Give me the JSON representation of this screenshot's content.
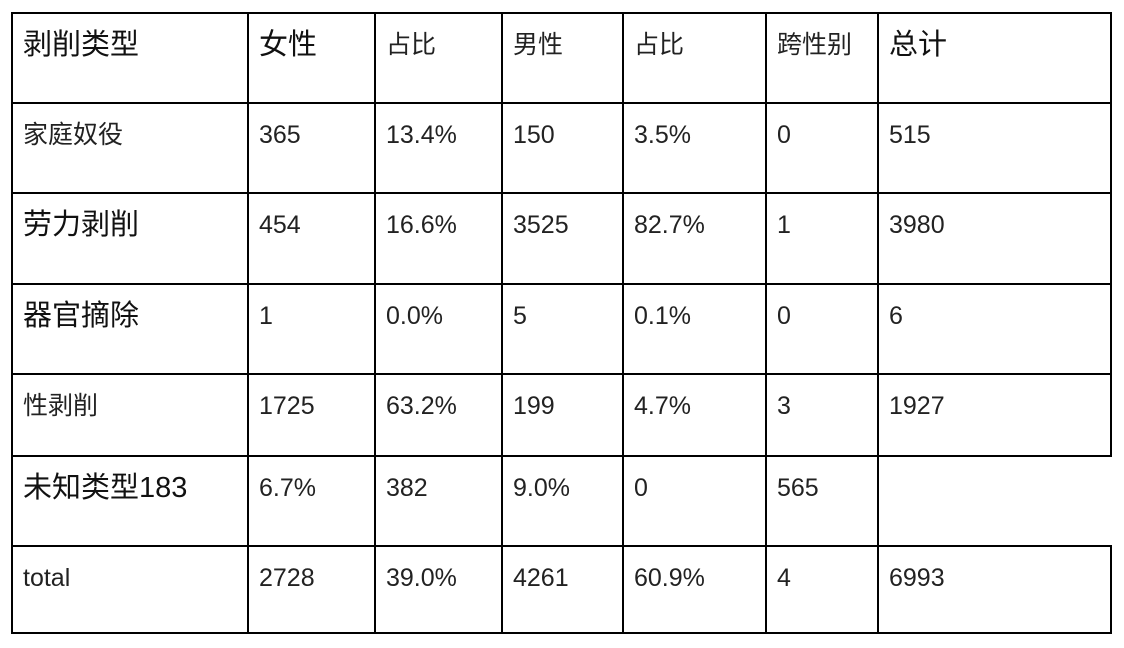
{
  "table": {
    "header": [
      "剥削类型",
      "女性",
      "占比",
      "男性",
      "占比",
      "跨性别",
      "总计"
    ],
    "rows": [
      [
        "家庭奴役",
        "365",
        "13.4%",
        "150",
        "3.5%",
        "0",
        "515"
      ],
      [
        "劳力剥削",
        "454",
        "16.6%",
        "3525",
        "82.7%",
        "1",
        "3980"
      ],
      [
        "器官摘除",
        "1",
        "0.0%",
        "5",
        "0.1%",
        "0",
        "6"
      ],
      [
        "性剥削",
        "1725",
        "63.2%",
        "199",
        "4.7%",
        "3",
        "1927"
      ],
      [
        "未知类型183",
        "6.7%",
        "382",
        "9.0%",
        "0",
        "565",
        ""
      ],
      [
        "total",
        "2728",
        "39.0%",
        "4261",
        "60.9%",
        "4",
        "6993"
      ]
    ]
  }
}
